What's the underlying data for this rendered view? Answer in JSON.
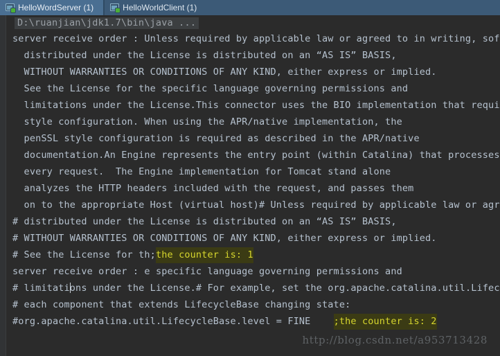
{
  "window": {
    "tabs": [
      {
        "label": "HelloWordServer (1)",
        "icon": "run-process-icon",
        "active": true
      },
      {
        "label": "HelloWorldClient (1)",
        "icon": "run-process-icon",
        "active": false
      }
    ]
  },
  "console": {
    "command_line": "D:\\ruanjian\\jdk1.7\\bin\\java ...",
    "lines": [
      {
        "segments": [
          {
            "text": "server receive order : Unless required by applicable law or agreed to in writing, softwa",
            "style": "normal"
          }
        ]
      },
      {
        "segments": [
          {
            "text": "  distributed under the License is distributed on an “AS IS” BASIS,",
            "style": "normal"
          }
        ]
      },
      {
        "segments": [
          {
            "text": "  WITHOUT WARRANTIES OR CONDITIONS OF ANY KIND, either express or implied.",
            "style": "normal"
          }
        ]
      },
      {
        "segments": [
          {
            "text": "  See the License for the specific language governing permissions and",
            "style": "normal"
          }
        ]
      },
      {
        "segments": [
          {
            "text": "  limitations under the License.This connector uses the BIO implementation that requires",
            "style": "normal"
          }
        ]
      },
      {
        "segments": [
          {
            "text": "  style configuration. When using the APR/native implementation, the",
            "style": "normal"
          }
        ]
      },
      {
        "segments": [
          {
            "text": "  penSSL style configuration is required as described in the APR/native",
            "style": "normal"
          }
        ]
      },
      {
        "segments": [
          {
            "text": "  documentation.An Engine represents the entry point (within Catalina) that processes",
            "style": "normal"
          }
        ]
      },
      {
        "segments": [
          {
            "text": "  every request.  The Engine implementation for Tomcat stand alone",
            "style": "normal"
          }
        ]
      },
      {
        "segments": [
          {
            "text": "  analyzes the HTTP headers included with the request, and passes them",
            "style": "normal"
          }
        ]
      },
      {
        "segments": [
          {
            "text": "  on to the appropriate Host (virtual host)# Unless required by applicable law or agreed",
            "style": "normal"
          }
        ]
      },
      {
        "segments": [
          {
            "text": "# distributed under the License is distributed on an “AS IS” BASIS,",
            "style": "normal"
          }
        ]
      },
      {
        "segments": [
          {
            "text": "# WITHOUT WARRANTIES OR CONDITIONS OF ANY KIND, either express or implied.",
            "style": "normal"
          }
        ]
      },
      {
        "segments": [
          {
            "text": "# See the License for th;",
            "style": "normal"
          },
          {
            "text": "the counter is: 1",
            "style": "highlight"
          }
        ]
      },
      {
        "segments": [
          {
            "text": "server receive order : e specific language governing permissions and",
            "style": "normal"
          }
        ]
      },
      {
        "segments": [
          {
            "text": "# limitati",
            "style": "normal"
          },
          {
            "text": "",
            "style": "caret"
          },
          {
            "text": "ons under the License.# For example, set the org.apache.catalina.util.Lifecycl",
            "style": "normal"
          }
        ]
      },
      {
        "segments": [
          {
            "text": "# each component that extends LifecycleBase changing state:",
            "style": "normal"
          }
        ]
      },
      {
        "segments": [
          {
            "text": "#org.apache.catalina.util.LifecycleBase.level = FINE    ",
            "style": "normal"
          },
          {
            "text": ";the counter is: 2",
            "style": "highlight"
          }
        ]
      }
    ]
  },
  "watermark": {
    "text": "http://blog.csdn.net/a953713428"
  },
  "colors": {
    "tab_active_bg": "#4a6f92",
    "tab_inactive_bg": "#3c5a77",
    "console_bg": "#2b2b2b",
    "text": "#b6c2cf",
    "highlight_bg": "#3b3b14",
    "highlight_fg": "#d6d62e",
    "command_line_bg": "#3c3f41",
    "command_line_fg": "#9aa0a6",
    "watermark_fg": "#5f6366"
  }
}
